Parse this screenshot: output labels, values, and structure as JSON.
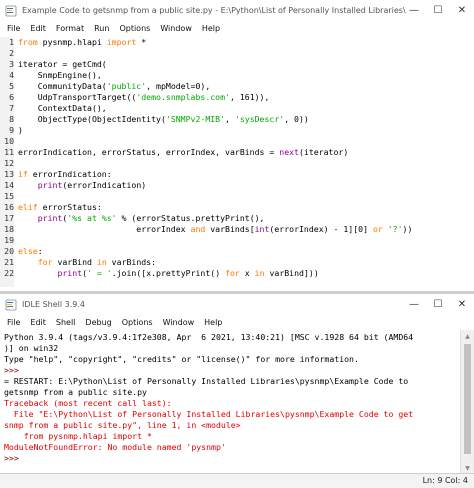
{
  "editor": {
    "title": "Example Code to getsnmp from a public site.py - E:\\Python\\List of Personally Installed Libraries\\",
    "menu": [
      "File",
      "Edit",
      "Format",
      "Run",
      "Options",
      "Window",
      "Help"
    ],
    "line_numbers": [
      "1",
      "2",
      "3",
      "4",
      "5",
      "6",
      "7",
      "8",
      "9",
      "10",
      "11",
      "12",
      "13",
      "14",
      "15",
      "16",
      "17",
      "18",
      "19",
      "20",
      "21",
      "22"
    ],
    "code": [
      [
        [
          "kw",
          "from"
        ],
        [
          "t",
          " pysnmp.hlapi "
        ],
        [
          "kw",
          "import"
        ],
        [
          "t",
          " *"
        ]
      ],
      [
        [
          "t",
          ""
        ]
      ],
      [
        [
          "t",
          "iterator = getCmd("
        ]
      ],
      [
        [
          "t",
          "    SnmpEngine(),"
        ]
      ],
      [
        [
          "t",
          "    CommunityData("
        ],
        [
          "str",
          "'public'"
        ],
        [
          "t",
          ", mpModel=0),"
        ]
      ],
      [
        [
          "t",
          "    UdpTransportTarget(("
        ],
        [
          "str",
          "'demo.snmplabs.com'"
        ],
        [
          "t",
          ", 161)),"
        ]
      ],
      [
        [
          "t",
          "    ContextData(),"
        ]
      ],
      [
        [
          "t",
          "    ObjectType(ObjectIdentity("
        ],
        [
          "str",
          "'SNMPv2-MIB'"
        ],
        [
          "t",
          ", "
        ],
        [
          "str",
          "'sysDescr'"
        ],
        [
          "t",
          ", 0))"
        ]
      ],
      [
        [
          "t",
          ")"
        ]
      ],
      [
        [
          "t",
          ""
        ]
      ],
      [
        [
          "t",
          "errorIndication, errorStatus, errorIndex, varBinds = "
        ],
        [
          "bi",
          "next"
        ],
        [
          "t",
          "(iterator)"
        ]
      ],
      [
        [
          "t",
          ""
        ]
      ],
      [
        [
          "kw",
          "if"
        ],
        [
          "t",
          " errorIndication:"
        ]
      ],
      [
        [
          "t",
          "    "
        ],
        [
          "bi",
          "print"
        ],
        [
          "t",
          "(errorIndication)"
        ]
      ],
      [
        [
          "t",
          ""
        ]
      ],
      [
        [
          "kw",
          "elif"
        ],
        [
          "t",
          " errorStatus:"
        ]
      ],
      [
        [
          "t",
          "    "
        ],
        [
          "bi",
          "print"
        ],
        [
          "t",
          "("
        ],
        [
          "str",
          "'%s at %s'"
        ],
        [
          "t",
          " % (errorStatus.prettyPrint(),"
        ]
      ],
      [
        [
          "t",
          "                        errorIndex "
        ],
        [
          "kw",
          "and"
        ],
        [
          "t",
          " varBinds["
        ],
        [
          "bi",
          "int"
        ],
        [
          "t",
          "(errorIndex) - 1][0] "
        ],
        [
          "kw",
          "or"
        ],
        [
          "t",
          " "
        ],
        [
          "str",
          "'?'"
        ],
        [
          "t",
          "))"
        ]
      ],
      [
        [
          "t",
          ""
        ]
      ],
      [
        [
          "kw",
          "else"
        ],
        [
          "t",
          ":"
        ]
      ],
      [
        [
          "t",
          "    "
        ],
        [
          "kw",
          "for"
        ],
        [
          "t",
          " varBind "
        ],
        [
          "kw",
          "in"
        ],
        [
          "t",
          " varBinds:"
        ]
      ],
      [
        [
          "t",
          "        "
        ],
        [
          "bi",
          "print"
        ],
        [
          "t",
          "("
        ],
        [
          "str",
          "' = '"
        ],
        [
          "t",
          "."
        ],
        [
          "t",
          "join([x.prettyPrint() "
        ],
        [
          "kw",
          "for"
        ],
        [
          "t",
          " x "
        ],
        [
          "kw",
          "in"
        ],
        [
          "t",
          " varBind]))"
        ]
      ]
    ]
  },
  "shell": {
    "title": "IDLE Shell 3.9.4",
    "menu": [
      "File",
      "Edit",
      "Shell",
      "Debug",
      "Options",
      "Window",
      "Help"
    ],
    "lines": [
      [
        [
          "out",
          "Python 3.9.4 (tags/v3.9.4:1f2e308, Apr  6 2021, 13:40:21) [MSC v.1928 64 bit (AMD64"
        ]
      ],
      [
        [
          "out",
          ")] on win32"
        ]
      ],
      [
        [
          "out",
          "Type \"help\", \"copyright\", \"credits\" or \"license()\" for more information."
        ]
      ],
      [
        [
          "prompt",
          ">>>"
        ]
      ],
      [
        [
          "out",
          "= RESTART: E:\\Python\\List of Personally Installed Libraries\\pysnmp\\Example Code to"
        ]
      ],
      [
        [
          "out",
          "getsnmp from a public site.py"
        ]
      ],
      [
        [
          "err",
          "Traceback (most recent call last):"
        ]
      ],
      [
        [
          "err",
          "  File \"E:\\Python\\List of Personally Installed Libraries\\pysnmp\\Example Code to get"
        ]
      ],
      [
        [
          "err",
          "snmp from a public site.py\", line 1, in <module>"
        ]
      ],
      [
        [
          "err",
          "    from pysnmp.hlapi import *"
        ]
      ],
      [
        [
          "err",
          "ModuleNotFoundError: No module named 'pysnmp'"
        ]
      ],
      [
        [
          "prompt",
          ">>> "
        ]
      ]
    ],
    "status": "Ln: 9   Col: 4"
  },
  "window_controls": {
    "minimize": "—",
    "maximize": "☐",
    "close": "✕"
  },
  "icons": {
    "app": "idle-python-icon"
  }
}
